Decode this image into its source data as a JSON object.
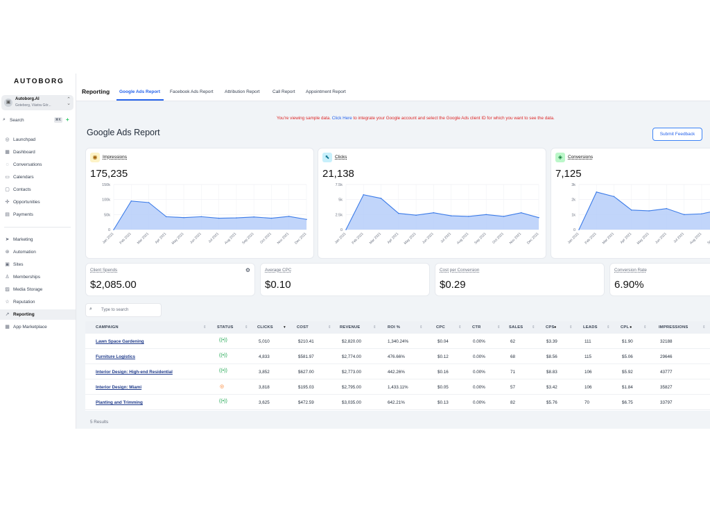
{
  "sidebar": {
    "logo": "AUTOBORG",
    "account": {
      "name": "Autoborg.AI",
      "subtitle": "Goteborg, Västra Gör..."
    },
    "search": {
      "label": "Search",
      "shortcut": "⌘K"
    },
    "items": [
      {
        "label": "Launchpad",
        "icon": "rocket-icon"
      },
      {
        "label": "Dashboard",
        "icon": "grid-icon"
      },
      {
        "label": "Conversations",
        "icon": "chat-icon"
      },
      {
        "label": "Calendars",
        "icon": "calendar-icon"
      },
      {
        "label": "Contacts",
        "icon": "contacts-icon"
      },
      {
        "label": "Opportunities",
        "icon": "opportunities-icon"
      },
      {
        "label": "Payments",
        "icon": "payments-icon"
      },
      {
        "label": "Marketing",
        "icon": "send-icon"
      },
      {
        "label": "Automation",
        "icon": "automation-icon"
      },
      {
        "label": "Sites",
        "icon": "sites-icon"
      },
      {
        "label": "Memberships",
        "icon": "memberships-icon"
      },
      {
        "label": "Media Storage",
        "icon": "media-icon"
      },
      {
        "label": "Reputation",
        "icon": "star-icon"
      },
      {
        "label": "Reporting",
        "icon": "trend-icon",
        "active": true
      },
      {
        "label": "App Marketplace",
        "icon": "apps-icon"
      }
    ]
  },
  "topbar": {
    "title": "Reporting",
    "tabs": [
      {
        "label": "Google Ads Report",
        "active": true
      },
      {
        "label": "Facebook Ads Report"
      },
      {
        "label": "Attribution Report"
      },
      {
        "label": "Call Report"
      },
      {
        "label": "Appointment Report"
      }
    ]
  },
  "notice": {
    "before": "You're viewing sample data.",
    "link": "Click Here",
    "after": "to integrate your Google account and select the Google Ads client ID for which you want to see the data."
  },
  "page_title": "Google Ads Report",
  "feedback_button": "Submit Feedback",
  "months": [
    "Jan 2021",
    "Feb 2021",
    "Mar 2021",
    "Apr 2021",
    "May 2021",
    "Jun 2021",
    "Jul 2021",
    "Aug 2021",
    "Sep 2021",
    "Oct 2021",
    "Nov 2021",
    "Dec 2021"
  ],
  "metrics": [
    {
      "name": "Impressions",
      "value": "175,235",
      "icon": "eye-icon",
      "icon_bg": "#fdf3c7",
      "yticks": [
        "150k",
        "100k",
        "50k",
        "0"
      ],
      "ymax": 150,
      "series": [
        0,
        95,
        90,
        43,
        40,
        43,
        38,
        39,
        42,
        38,
        44,
        34
      ]
    },
    {
      "name": "Clicks",
      "value": "21,138",
      "icon": "cursor-icon",
      "icon_bg": "#c8f0fb",
      "yticks": [
        "7.5k",
        "5k",
        "2.5k",
        "0"
      ],
      "ymax": 7.5,
      "series": [
        0,
        5.8,
        5.2,
        2.7,
        2.4,
        2.8,
        2.3,
        2.2,
        2.5,
        2.2,
        2.8,
        2.0
      ]
    },
    {
      "name": "Conversions",
      "value": "7,125",
      "icon": "diamond-icon",
      "icon_bg": "#bbf7c9",
      "yticks": [
        "3k",
        "2k",
        "1k",
        "0"
      ],
      "ymax": 3,
      "series": [
        0,
        2.5,
        2.2,
        1.3,
        1.25,
        1.4,
        1.0,
        1.05,
        1.3,
        1.05,
        1.2,
        0.9
      ]
    }
  ],
  "kpis": [
    {
      "name": "Client Spends",
      "value": "$2,085.00",
      "gear": true
    },
    {
      "name": "Average CPC",
      "value": "$0.10"
    },
    {
      "name": "Cost per Conversion",
      "value": "$0.29"
    },
    {
      "name": "Conversion Rate",
      "value": "6.90%"
    }
  ],
  "table": {
    "search_placeholder": "Type to search",
    "columns": [
      "CAMPAIGN",
      "STATUS",
      "CLICKS",
      "COST",
      "REVENUE",
      "ROI %",
      "CPC",
      "CTR",
      "SALES",
      "CPS",
      "LEADS",
      "CPL",
      "IMPRESSIONS"
    ],
    "rows": [
      {
        "campaign": "Lawn Space Gardening",
        "status": "live",
        "clicks": "5,010",
        "cost": "$210.41",
        "revenue": "$2,820.00",
        "roi": "1,340.24%",
        "cpc": "$0.04",
        "ctr": "0.00%",
        "sales": "62",
        "cps": "$3.39",
        "leads": "111",
        "cpl": "$1.90",
        "impressions": "32188"
      },
      {
        "campaign": "Furniture Logistics",
        "status": "live",
        "clicks": "4,833",
        "cost": "$581.97",
        "revenue": "$2,774.00",
        "roi": "476.66%",
        "cpc": "$0.12",
        "ctr": "0.00%",
        "sales": "68",
        "cps": "$8.56",
        "leads": "115",
        "cpl": "$5.06",
        "impressions": "29646"
      },
      {
        "campaign": "Interior Design: High-end Residential",
        "status": "live",
        "clicks": "3,852",
        "cost": "$627.00",
        "revenue": "$2,773.00",
        "roi": "442.26%",
        "cpc": "$0.16",
        "ctr": "0.00%",
        "sales": "71",
        "cps": "$8.83",
        "leads": "106",
        "cpl": "$5.92",
        "impressions": "43777"
      },
      {
        "campaign": "Interior Design: Miami",
        "status": "paused",
        "clicks": "3,818",
        "cost": "$195.03",
        "revenue": "$2,795.00",
        "roi": "1,433.11%",
        "cpc": "$0.05",
        "ctr": "0.00%",
        "sales": "57",
        "cps": "$3.42",
        "leads": "106",
        "cpl": "$1.84",
        "impressions": "35827"
      },
      {
        "campaign": "Planting and Trimming",
        "status": "live",
        "clicks": "3,625",
        "cost": "$472.59",
        "revenue": "$3,035.00",
        "roi": "642.21%",
        "cpc": "$0.13",
        "ctr": "0.00%",
        "sales": "82",
        "cps": "$5.76",
        "leads": "70",
        "cpl": "$6.75",
        "impressions": "33797"
      }
    ],
    "results": "5 Results"
  }
}
